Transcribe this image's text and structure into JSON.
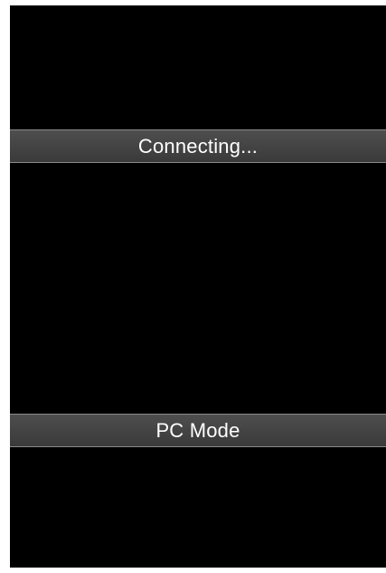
{
  "screen": {
    "status_text": "Connecting...",
    "mode_text": "PC Mode"
  },
  "colors": {
    "background": "#000000",
    "bar": "#444444",
    "text": "#ffffff"
  }
}
